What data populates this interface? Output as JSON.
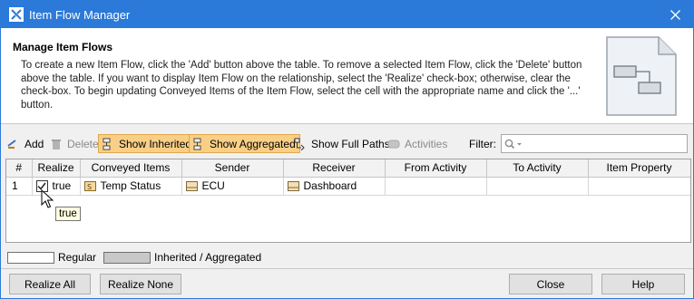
{
  "window": {
    "title": "Item Flow Manager"
  },
  "header": {
    "title": "Manage Item Flows",
    "description": "To create a new Item Flow, click the 'Add' button above the table. To remove a selected Item Flow, click the 'Delete' button above the table. If you want to display Item Flow on the relationship, select the 'Realize' check-box; otherwise, clear the check-box. To begin updating Conveyed Items of the Item Flow, select the cell with the appropriate name and click the '...' button."
  },
  "toolbar": {
    "add_label": "Add",
    "delete_label": "Delete",
    "show_inherited_label": "Show Inherited",
    "show_aggregated_label": "Show Aggregated",
    "show_full_paths_label": "Show Full Paths",
    "activities_label": "Activities",
    "filter_label": "Filter:",
    "show_inherited_toggled": true,
    "show_aggregated_toggled": true,
    "delete_enabled": false,
    "activities_enabled": false
  },
  "table": {
    "columns": [
      "#",
      "Realize",
      "Conveyed Items",
      "Sender",
      "Receiver",
      "From Activity",
      "To Activity",
      "Item Property"
    ],
    "rows": [
      {
        "num": "1",
        "realize": "true",
        "realize_checked": true,
        "conveyed_items": "Temp Status",
        "sender": "ECU",
        "receiver": "Dashboard",
        "from_activity": "",
        "to_activity": "",
        "item_property": ""
      }
    ]
  },
  "tooltip": {
    "text": "true"
  },
  "legend": {
    "regular_label": "Regular",
    "inherited_label": "Inherited / Aggregated"
  },
  "buttons": {
    "realize_all": "Realize All",
    "realize_none": "Realize None",
    "close": "Close",
    "help": "Help"
  },
  "colors": {
    "titlebar": "#2b79d8",
    "toggle_active": "#f9cf86",
    "legend_inherited": "#c8c8c8"
  }
}
